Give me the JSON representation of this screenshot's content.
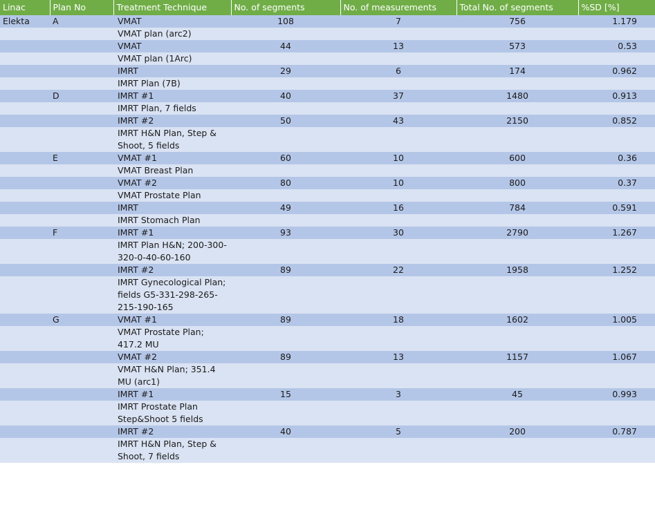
{
  "table": {
    "headers": [
      "Linac",
      "Plan No",
      "Treatment Technique",
      "No. of segments",
      "No. of measurements",
      "Total No. of segments",
      "%SD [%]"
    ],
    "rows": [
      [
        "Elekta",
        "A",
        "VMAT",
        "108",
        "7",
        "756",
        "1.179"
      ],
      [
        "",
        "",
        "VMAT plan (arc2)",
        "",
        "",
        "",
        ""
      ],
      [
        "",
        "",
        "VMAT",
        "44",
        "13",
        "573",
        "0.53"
      ],
      [
        "",
        "",
        "VMAT plan (1Arc)",
        "",
        "",
        "",
        ""
      ],
      [
        "",
        "",
        "IMRT",
        "29",
        "6",
        "174",
        "0.962"
      ],
      [
        "",
        "",
        "IMRT Plan (7B)",
        "",
        "",
        "",
        ""
      ],
      [
        "",
        "D",
        "IMRT #1",
        "40",
        "37",
        "1480",
        "0.913"
      ],
      [
        "",
        "",
        "IMRT Plan, 7 fields",
        "",
        "",
        "",
        ""
      ],
      [
        "",
        "",
        "IMRT #2",
        "50",
        "43",
        "2150",
        "0.852"
      ],
      [
        "",
        "",
        "IMRT H&N Plan, Step & Shoot, 5 fields",
        "",
        "",
        "",
        ""
      ],
      [
        "",
        "E",
        "VMAT #1",
        "60",
        "10",
        "600",
        "0.36"
      ],
      [
        "",
        "",
        "VMAT Breast Plan",
        "",
        "",
        "",
        ""
      ],
      [
        "",
        "",
        "VMAT #2",
        "80",
        "10",
        "800",
        "0.37"
      ],
      [
        "",
        "",
        "VMAT Prostate Plan",
        "",
        "",
        "",
        ""
      ],
      [
        "",
        "",
        "IMRT",
        "49",
        "16",
        "784",
        "0.591"
      ],
      [
        "",
        "",
        "IMRT Stomach Plan",
        "",
        "",
        "",
        ""
      ],
      [
        "",
        "F",
        "IMRT #1",
        "93",
        "30",
        "2790",
        "1.267"
      ],
      [
        "",
        "",
        "IMRT Plan H&N; 200-300-320-0-40-60-160",
        "",
        "",
        "",
        ""
      ],
      [
        "",
        "",
        "IMRT #2",
        "89",
        "22",
        "1958",
        "1.252"
      ],
      [
        "",
        "",
        "IMRT Gynecological Plan; fields G5-331-298-265-215-190-165",
        "",
        "",
        "",
        ""
      ],
      [
        "",
        "G",
        "VMAT #1",
        "89",
        "18",
        "1602",
        "1.005"
      ],
      [
        "",
        "",
        "VMAT Prostate Plan; 417.2 MU",
        "",
        "",
        "",
        ""
      ],
      [
        "",
        "",
        "VMAT #2",
        "89",
        "13",
        "1157",
        "1.067"
      ],
      [
        "",
        "",
        "VMAT H&N Plan; 351.4 MU (arc1)",
        "",
        "",
        "",
        ""
      ],
      [
        "",
        "",
        "IMRT #1",
        "15",
        "3",
        "45",
        "0.993"
      ],
      [
        "",
        "",
        "IMRT Prostate Plan Step&Shoot 5 fields",
        "",
        "",
        "",
        ""
      ],
      [
        "",
        "",
        "IMRT #2",
        "40",
        "5",
        "200",
        "0.787"
      ],
      [
        "",
        "",
        "IMRT H&N Plan, Step & Shoot, 7 fields",
        "",
        "",
        "",
        ""
      ]
    ]
  },
  "colors": {
    "header": "#70ad47",
    "band_dark": "#b4c6e7",
    "band_light": "#dae3f3"
  }
}
